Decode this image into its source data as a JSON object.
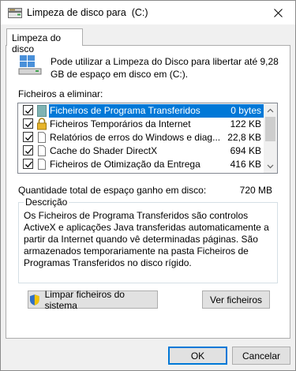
{
  "window": {
    "title": "Limpeza de disco para  (C:)",
    "close_icon": "close-icon",
    "app_icon": "disk-cleanup-icon"
  },
  "tab": {
    "label": "Limpeza do disco"
  },
  "info": {
    "text": "Pode utilizar a Limpeza do Disco para libertar até 9,28 GB de espaço em disco em  (C:)."
  },
  "files_section": {
    "label": "Ficheiros a eliminar:",
    "items": [
      {
        "label": "Ficheiros de Programa Transferidos",
        "size": "0 bytes",
        "checked": true,
        "selected": true,
        "icon": "folder-icon"
      },
      {
        "label": "Ficheiros Temporários da Internet",
        "size": "122 KB",
        "checked": true,
        "selected": false,
        "icon": "lock-icon"
      },
      {
        "label": "Relatórios de erros do Windows e diag...",
        "size": "22,8 KB",
        "checked": true,
        "selected": false,
        "icon": "document-icon"
      },
      {
        "label": "Cache do Shader DirectX",
        "size": "694 KB",
        "checked": true,
        "selected": false,
        "icon": "document-icon"
      },
      {
        "label": "Ficheiros de Otimização da Entrega",
        "size": "416 KB",
        "checked": true,
        "selected": false,
        "icon": "document-icon"
      }
    ]
  },
  "total": {
    "label": "Quantidade total de espaço ganho em disco:",
    "value": "720 MB"
  },
  "description": {
    "title": "Descrição",
    "text": "Os Ficheiros de Programa Transferidos são controlos ActiveX e aplicações Java transferidas automaticamente a partir da Internet quando vê determinadas páginas. São armazenados temporariamente na pasta Ficheiros de Programas Transferidos no disco rígido."
  },
  "buttons": {
    "cleanup_system": "Limpar ficheiros do sistema",
    "view_files": "Ver ficheiros",
    "ok": "OK",
    "cancel": "Cancelar"
  },
  "colors": {
    "selection": "#0078d7",
    "window_bg": "#f0f0f0",
    "panel_bg": "#ffffff"
  }
}
